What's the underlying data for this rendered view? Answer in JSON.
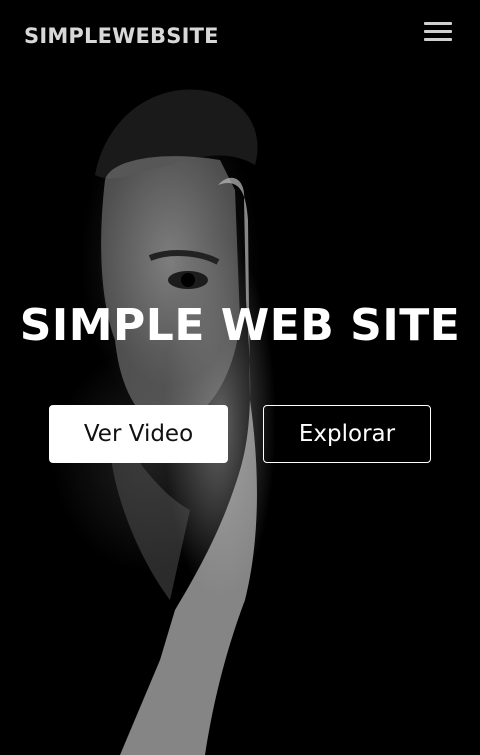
{
  "navbar": {
    "brand": "SIMPLEWEBSITE",
    "menu_icon": "hamburger-menu-icon"
  },
  "hero": {
    "title": "SIMPLE WEB SITE",
    "background": "black-and-white portrait photo",
    "buttons": {
      "primary_label": "Ver Video",
      "secondary_label": "Explorar"
    }
  },
  "colors": {
    "background": "#000000",
    "text": "#ffffff",
    "brand_text": "#d8d8d8",
    "primary_button_bg": "#ffffff",
    "primary_button_text": "#111111"
  }
}
